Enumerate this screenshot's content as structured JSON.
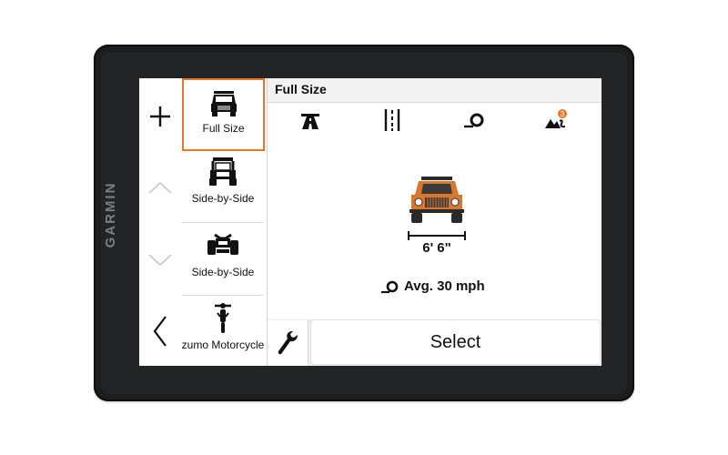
{
  "device": {
    "brand": "GARMIN"
  },
  "rail": {
    "add_icon": "plus-icon",
    "up_icon": "chevron-up-icon",
    "down_icon": "chevron-down-icon",
    "back_icon": "chevron-left-icon"
  },
  "vehicles": [
    {
      "label": "Full Size",
      "icon": "jeep-icon",
      "selected": true
    },
    {
      "label": "Side-by-Side",
      "icon": "utv-icon",
      "selected": false
    },
    {
      "label": "Side-by-Side",
      "icon": "atv-icon",
      "selected": false
    },
    {
      "label": "zumo Motorcycle",
      "icon": "motorcycle-icon",
      "selected": false
    }
  ],
  "main": {
    "title": "Full Size",
    "tabs": [
      "road-icon",
      "lane-width-icon",
      "speed-icon",
      "terrain-icon"
    ],
    "terrain_badge": "3",
    "width_text": "6' 6\"",
    "speed_text": "Avg. 30 mph",
    "select_label": "Select"
  },
  "colors": {
    "accent": "#e8762b",
    "vehicle_body": "#d9772e"
  }
}
